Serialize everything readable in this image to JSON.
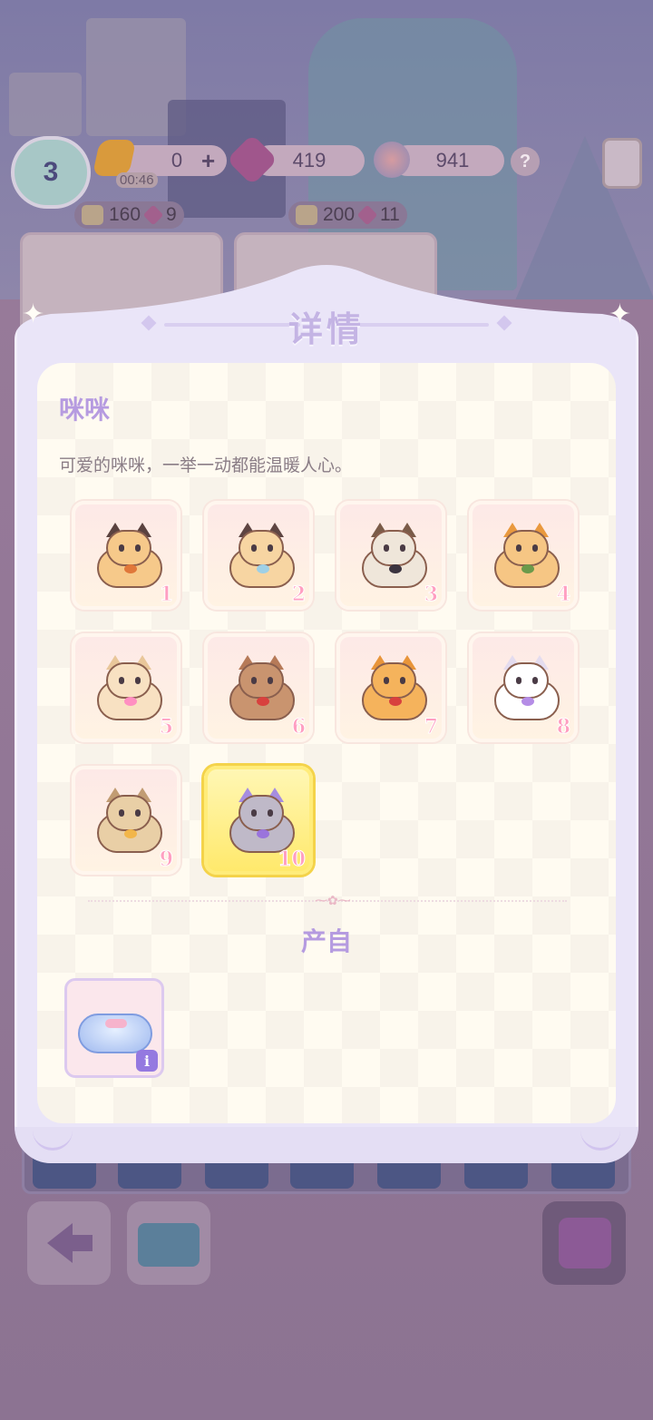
{
  "hud": {
    "level": "3",
    "energy": "0",
    "energy_add": "+",
    "timer": "00:46",
    "gems": "419",
    "stars": "941",
    "help": "?"
  },
  "shop": {
    "items": [
      {
        "coins": "160",
        "gems": "9"
      },
      {
        "coins": "200",
        "gems": "11"
      }
    ]
  },
  "panel": {
    "title": "详情",
    "item_name": "咪咪",
    "item_description": "可爱的咪咪，一举一动都能温暖人心。",
    "selected_level": 10,
    "levels": [
      {
        "number": "1",
        "colors": {
          "head": "#f6c98a",
          "ear": "#5a423f",
          "accent": "#e0773a"
        }
      },
      {
        "number": "2",
        "colors": {
          "head": "#f7d5a2",
          "ear": "#5e4542",
          "accent": "#9ed0e6"
        }
      },
      {
        "number": "3",
        "colors": {
          "head": "#efe6da",
          "ear": "#7a5b48",
          "accent": "#3b3440"
        }
      },
      {
        "number": "4",
        "colors": {
          "head": "#f6c684",
          "ear": "#e9993e",
          "accent": "#6b9a4a"
        }
      },
      {
        "number": "5",
        "colors": {
          "head": "#f8e1c2",
          "ear": "#e9c79a",
          "accent": "#ff8fc1"
        }
      },
      {
        "number": "6",
        "colors": {
          "head": "#c9946f",
          "ear": "#b67a58",
          "accent": "#d8413e"
        }
      },
      {
        "number": "7",
        "colors": {
          "head": "#f5b35c",
          "ear": "#e8953a",
          "accent": "#d8413e"
        }
      },
      {
        "number": "8",
        "colors": {
          "head": "#ffffff",
          "ear": "#e4dcef",
          "accent": "#b58de6"
        }
      },
      {
        "number": "9",
        "colors": {
          "head": "#e9cfa6",
          "ear": "#c19c73",
          "accent": "#f2b64a"
        }
      },
      {
        "number": "10",
        "colors": {
          "head": "#bfb9c8",
          "ear": "#a68de0",
          "accent": "#9a74dc"
        }
      }
    ],
    "source_title": "产自",
    "source_item_icon": "cat-bed-cushion-icon",
    "info_badge": "i"
  }
}
